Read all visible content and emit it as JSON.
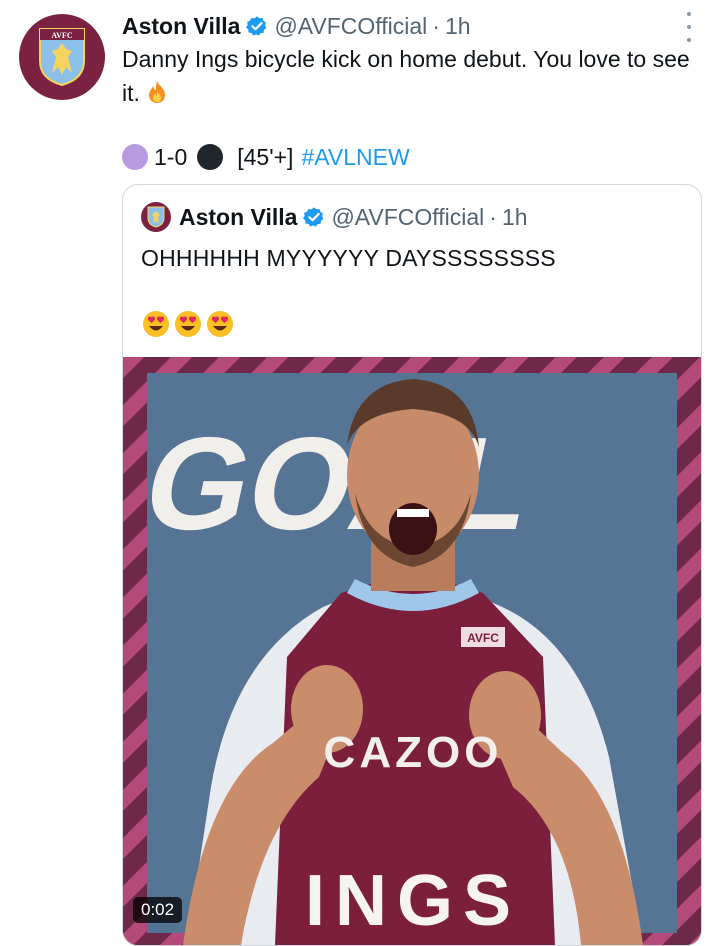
{
  "tweet": {
    "author_name": "Aston Villa",
    "handle": "@AVFCOfficial",
    "separator": "·",
    "time": "1h",
    "text": "Danny Ings bicycle kick on home debut. You love to see it.",
    "score": "1-0",
    "minute": "[45'+]",
    "hashtag": "#AVLNEW",
    "icons": {
      "verified": "verified-badge-icon",
      "fire": "fire-icon",
      "more": "more-options-icon"
    },
    "colors": {
      "club": "#7b2142",
      "verified": "#1d9bf0",
      "home_circle": "#b79ae0",
      "away_circle": "#20262c"
    }
  },
  "quote": {
    "author_name": "Aston Villa",
    "handle": "@AVFCOfficial",
    "separator": "·",
    "time": "1h",
    "text": "OHHHHHH MYYYYYY DAYSSSSSSSS",
    "emojis": [
      "heart-eyes-emoji",
      "heart-eyes-emoji",
      "heart-eyes-emoji"
    ],
    "media": {
      "headline": "GOAL",
      "player": "INGS",
      "shirt_sponsor": "CAZOO",
      "crest": "AVFC",
      "duration": "0:02"
    }
  }
}
